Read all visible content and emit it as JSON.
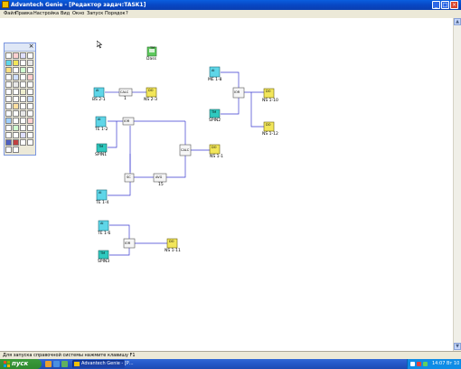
{
  "window": {
    "title": "Advantech Genie - [Редактор задач:TASK1]",
    "controls": [
      "minimize-icon",
      "maximize-icon",
      "close-icon"
    ]
  },
  "menu": {
    "items": [
      "Файл",
      "Правка",
      "Настройка",
      "Вид",
      "Окно",
      "Запуск",
      "Порядок",
      "?"
    ]
  },
  "toolbox": {
    "close_glyph": "×"
  },
  "diagram": {
    "labels": {
      "dass": "Dass",
      "bs21": "BS 2-1",
      "blk1": "1",
      "ns23": "NS 2-3",
      "me18": "ME 1-8",
      "ns110": "NS 1-10",
      "ns112": "NS 1-12",
      "spin2": "SPIN2",
      "te12": "TE 1-2",
      "spin1": "SPIN1",
      "ns11": "NS 1-1",
      "te14": "TE 1-4",
      "blk15": "15",
      "te16": "TE 1-6",
      "spin3": "SPIN3",
      "ns111": "NS 1-11"
    },
    "block_codes": {
      "ai": "AI",
      "tm": "TM",
      "do": "DO",
      "ior": "IOR",
      "calc": "CALC",
      "sc": "SC",
      "avg": "AVG"
    }
  },
  "status": {
    "text": "Для запуска справочной системы нажмите клавишу F1"
  },
  "taskbar": {
    "start_label": "пуск",
    "task_label": "Advantech Genie - [Р...",
    "clock": "14:07 Вт 10"
  },
  "colors": {
    "titlebar": "#0a52d8",
    "ai_block": "#5fd6e8",
    "tm_block": "#2fc9bf",
    "do_block": "#f2e65a",
    "wire": "#3a3ad0",
    "taskbar": "#2457c8",
    "start": "#3a983a"
  }
}
